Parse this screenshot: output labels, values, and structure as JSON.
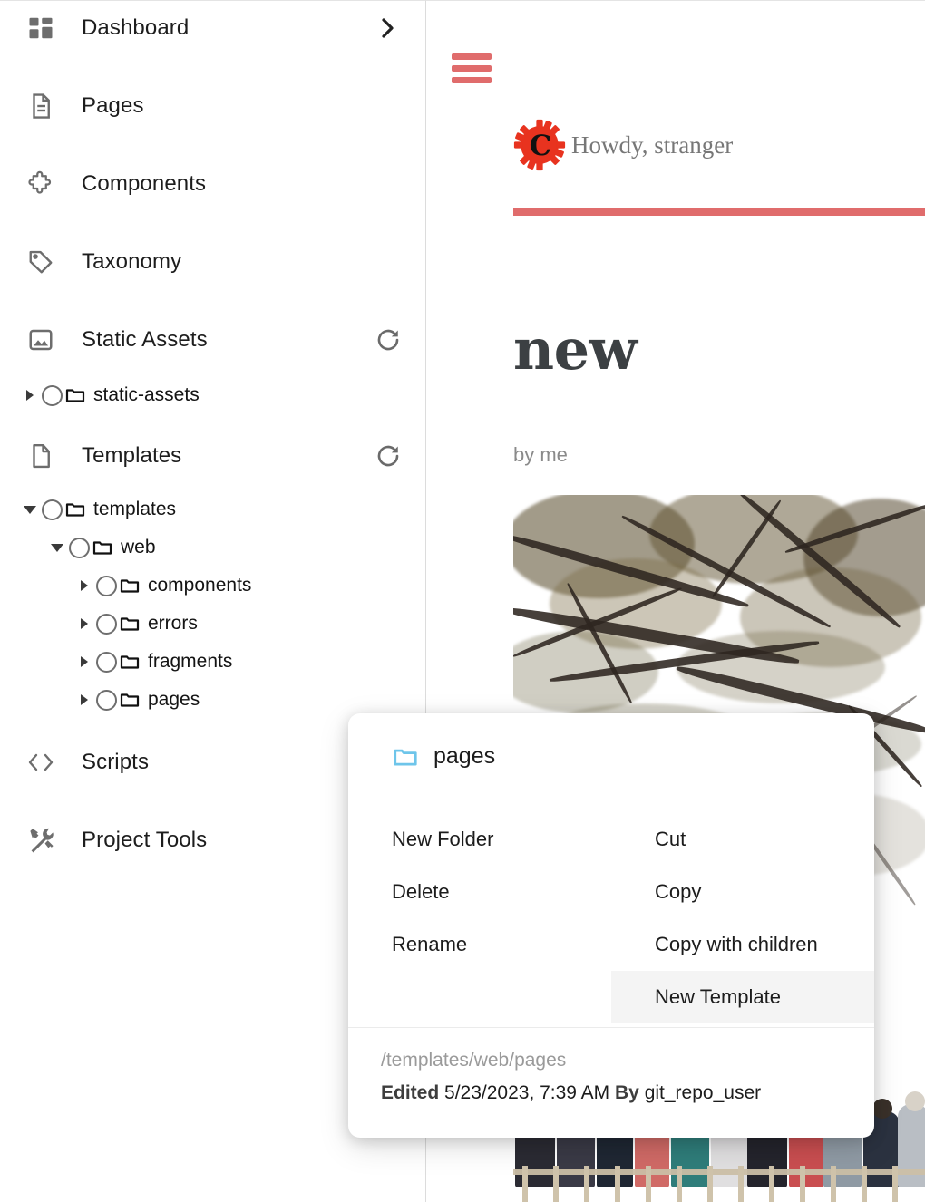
{
  "sidebar": {
    "nav_items": [
      {
        "label": "Dashboard",
        "icon": "dashboard-grid-icon",
        "trailing": "chevron-right-icon"
      },
      {
        "label": "Pages",
        "icon": "page-document-icon",
        "trailing": ""
      },
      {
        "label": "Components",
        "icon": "puzzle-piece-icon",
        "trailing": ""
      },
      {
        "label": "Taxonomy",
        "icon": "tag-icon",
        "trailing": ""
      },
      {
        "label": "Static Assets",
        "icon": "image-icon",
        "trailing": "refresh-icon"
      },
      {
        "label": "Templates",
        "icon": "file-icon",
        "trailing": "refresh-icon"
      },
      {
        "label": "Scripts",
        "icon": "code-brackets-icon",
        "trailing": ""
      },
      {
        "label": "Project Tools",
        "icon": "hammer-wrench-icon",
        "trailing": ""
      }
    ],
    "static_assets_tree": [
      {
        "label": "static-assets",
        "depth": 0,
        "expanded": false
      }
    ],
    "templates_tree": [
      {
        "label": "templates",
        "depth": 0,
        "expanded": true
      },
      {
        "label": "web",
        "depth": 1,
        "expanded": true
      },
      {
        "label": "components",
        "depth": 2,
        "expanded": false
      },
      {
        "label": "errors",
        "depth": 2,
        "expanded": false
      },
      {
        "label": "fragments",
        "depth": 2,
        "expanded": false
      },
      {
        "label": "pages",
        "depth": 2,
        "expanded": false
      }
    ]
  },
  "preview": {
    "menu_icon": "hamburger-menu-icon",
    "logo_icon": "red-gear-c-logo",
    "greeting": "Howdy, stranger",
    "title": "new",
    "byline": "by me",
    "hero_alt": "tree-branches-photo"
  },
  "context_menu": {
    "header_icon": "folder-icon",
    "header_name": "pages",
    "left_items": [
      {
        "label": "New Folder",
        "highlighted": false
      },
      {
        "label": "Delete",
        "highlighted": false
      },
      {
        "label": "Rename",
        "highlighted": false
      }
    ],
    "right_items": [
      {
        "label": "Cut",
        "highlighted": false
      },
      {
        "label": "Copy",
        "highlighted": false
      },
      {
        "label": "Copy with children",
        "highlighted": false
      },
      {
        "label": "New Template",
        "highlighted": true
      }
    ],
    "path": "/templates/web/pages",
    "edited_label": "Edited",
    "edited_date": "5/23/2023, 7:39 AM",
    "by_label": "By",
    "edited_user": "git_repo_user"
  },
  "colors": {
    "accent_red": "#e06c6c",
    "folder_blue": "#6ec5ea",
    "icon_gray": "#6d6d6d",
    "highlight_gray": "#f4f4f4",
    "title_dark": "#3c4043"
  }
}
